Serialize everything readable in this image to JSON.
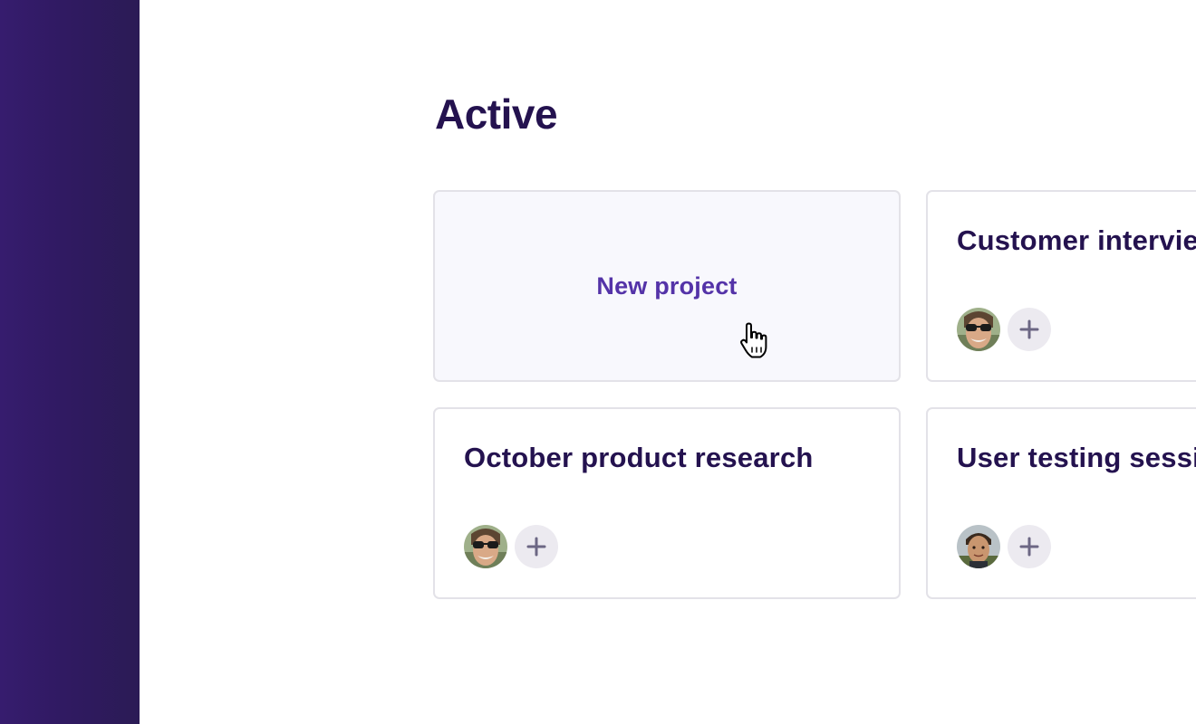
{
  "section": {
    "title": "Active"
  },
  "new_project": {
    "label": "New project"
  },
  "projects": [
    {
      "title": "Customer interviews"
    },
    {
      "title": "October product research"
    },
    {
      "title": "User testing sessions"
    }
  ],
  "colors": {
    "sidebar": "#301a62",
    "heading": "#24124f",
    "accent": "#5433a8",
    "card_border": "#e3e2e8",
    "new_card_bg": "#f8f8fd",
    "add_button_bg": "#eceaf0"
  },
  "icons": {
    "add_member": "plus-icon",
    "cursor": "pointer-hand-icon"
  }
}
